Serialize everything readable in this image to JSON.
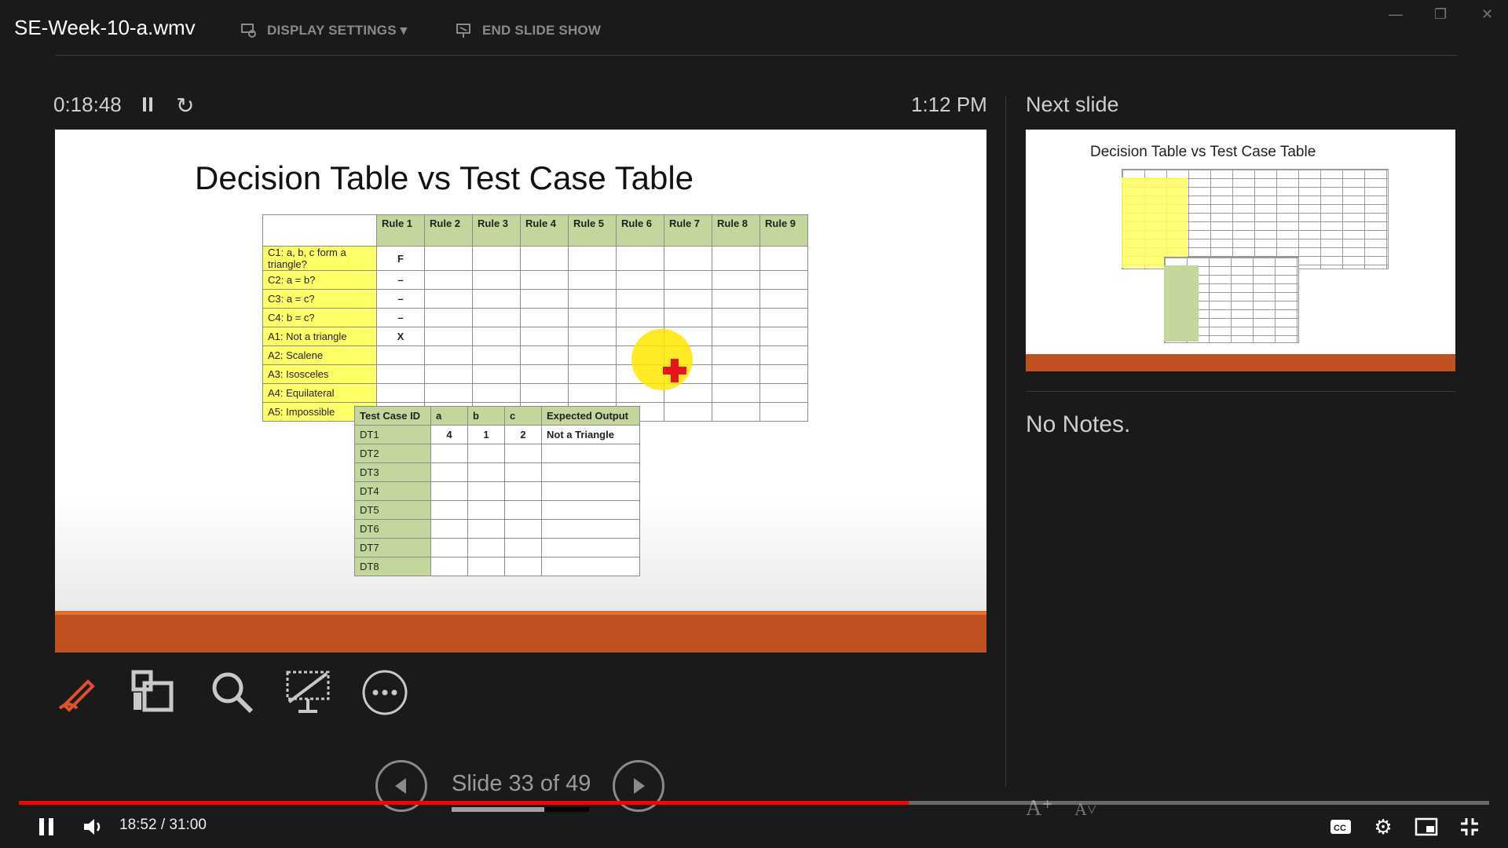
{
  "video": {
    "title": "SE-Week-10-a.wmv",
    "current_time": "18:52",
    "duration": "31:00",
    "time_display": "18:52 / 31:00",
    "progress_fraction": 0.605
  },
  "toolbar": {
    "display_settings": "DISPLAY SETTINGS ▾",
    "end_show": "END SLIDE SHOW"
  },
  "presenter": {
    "timer": "0:18:48",
    "clock": "1:12 PM",
    "next_label": "Next slide",
    "notes": "No Notes.",
    "slide_counter": "Slide 33 of 49",
    "slide_progress_fraction": 0.673
  },
  "slide": {
    "title": "Decision Table vs Test Case Table",
    "rules": [
      "Rule 1",
      "Rule 2",
      "Rule 3",
      "Rule 4",
      "Rule 5",
      "Rule 6",
      "Rule 7",
      "Rule 8",
      "Rule 9"
    ],
    "rows": [
      {
        "label": "C1: a, b, c form a triangle?",
        "rule1": "F"
      },
      {
        "label": "C2: a = b?",
        "rule1": "–"
      },
      {
        "label": "C3: a = c?",
        "rule1": "–"
      },
      {
        "label": "C4: b = c?",
        "rule1": "–"
      },
      {
        "label": "A1: Not a triangle",
        "rule1": "X"
      },
      {
        "label": "A2: Scalene",
        "rule1": ""
      },
      {
        "label": "A3: Isosceles",
        "rule1": ""
      },
      {
        "label": "A4: Equilateral",
        "rule1": ""
      },
      {
        "label": "A5: Impossible",
        "rule1": ""
      }
    ],
    "tc_headers": [
      "Test Case ID",
      "a",
      "b",
      "c",
      "Expected Output"
    ],
    "tc_rows": [
      {
        "id": "DT1",
        "a": "4",
        "b": "1",
        "c": "2",
        "out": "Not a Triangle"
      },
      {
        "id": "DT2",
        "a": "",
        "b": "",
        "c": "",
        "out": ""
      },
      {
        "id": "DT3",
        "a": "",
        "b": "",
        "c": "",
        "out": ""
      },
      {
        "id": "DT4",
        "a": "",
        "b": "",
        "c": "",
        "out": ""
      },
      {
        "id": "DT5",
        "a": "",
        "b": "",
        "c": "",
        "out": ""
      },
      {
        "id": "DT6",
        "a": "",
        "b": "",
        "c": "",
        "out": ""
      },
      {
        "id": "DT7",
        "a": "",
        "b": "",
        "c": "",
        "out": ""
      },
      {
        "id": "DT8",
        "a": "",
        "b": "",
        "c": "",
        "out": ""
      }
    ]
  },
  "next_slide": {
    "title": "Decision Table vs Test Case Table"
  },
  "icons": [
    "pen-icon",
    "see-all-slides-icon",
    "zoom-icon",
    "black-screen-icon",
    "more-options-icon",
    "prev-slide-icon",
    "next-slide-icon",
    "play-pause-icon",
    "volume-icon",
    "captions-icon",
    "settings-icon",
    "miniplayer-icon",
    "exit-fullscreen-icon"
  ],
  "colors": {
    "accent_orange": "#c0501f",
    "yellow": "#ffff66",
    "green": "#c3d69b",
    "yt_red": "#ff0000"
  }
}
